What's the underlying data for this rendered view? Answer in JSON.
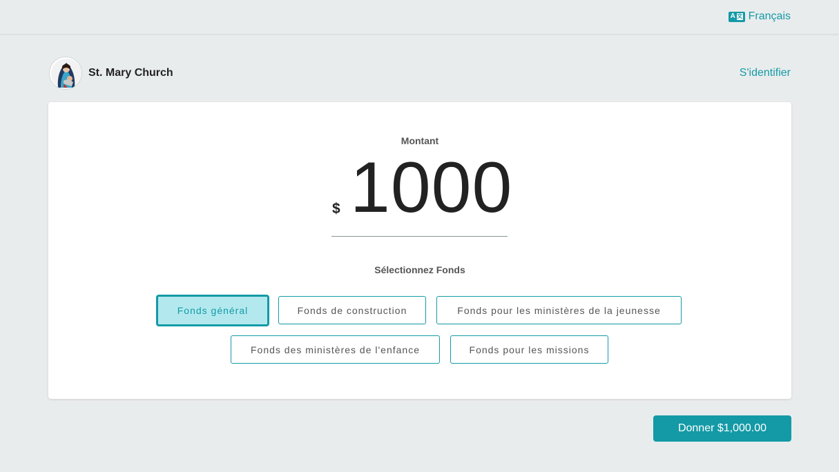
{
  "header": {
    "language_label": "Français",
    "language_icon": "translate-icon"
  },
  "organization": {
    "name": "St. Mary Church",
    "logo": "church-logo-madonna"
  },
  "auth": {
    "signin_label": "S'identifier"
  },
  "amount": {
    "label": "Montant",
    "currency_symbol": "$",
    "value": "1000"
  },
  "funds": {
    "label": "Sélectionnez Fonds",
    "items": [
      {
        "label": "Fonds général",
        "selected": true
      },
      {
        "label": "Fonds de construction",
        "selected": false
      },
      {
        "label": "Fonds pour les ministères de la jeunesse",
        "selected": false
      },
      {
        "label": "Fonds des ministères de l'enfance",
        "selected": false
      },
      {
        "label": "Fonds pour les missions",
        "selected": false
      }
    ]
  },
  "donate": {
    "label": "Donner $1,000.00"
  },
  "colors": {
    "accent": "#139aa6",
    "selected_bg": "#b3e9ee",
    "page_bg": "#e9eced"
  }
}
